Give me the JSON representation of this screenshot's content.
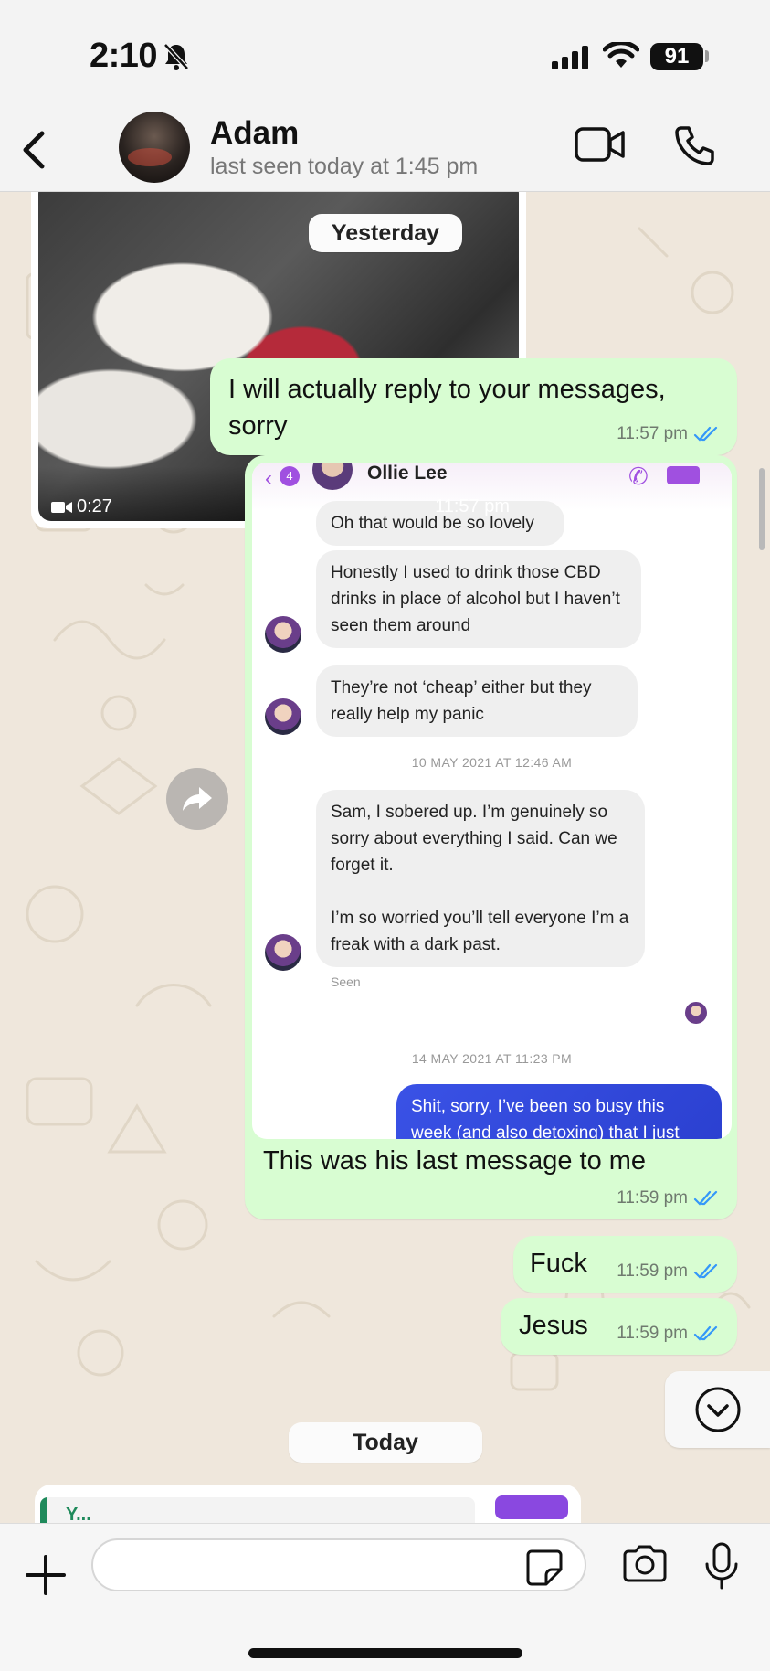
{
  "status_bar": {
    "time": "2:10",
    "battery": "91"
  },
  "header": {
    "contact_name": "Adam",
    "last_seen": "last seen today at 1:45 pm"
  },
  "media_message": {
    "duration": "0:27",
    "time": "11:57 pm"
  },
  "date_yesterday": "Yesterday",
  "messages": [
    {
      "text": "I will actually  reply to your messages, sorry",
      "time": "11:57 pm"
    },
    {
      "caption": "This was his last message to me",
      "time": "11:59 pm"
    },
    {
      "text": "Fuck",
      "time": "11:59 pm"
    },
    {
      "text": "Jesus",
      "time": "11:59 pm"
    }
  ],
  "screenshot": {
    "contact_name": "Ollie Lee",
    "badge": "4",
    "bubbles": [
      "Oh that would be so lovely",
      "Honestly I used to drink those CBD drinks in place of alcohol but I haven’t seen them around",
      "They’re not ‘cheap’ either but they really help my panic",
      "Sam, I sobered up. I’m genuinely so sorry about everything I said. Can we forget it.\n\nI’m so worried you’ll tell everyone I’m a freak with a dark past."
    ],
    "stamp_1": "10 MAY 2021 AT 12:46 AM",
    "seen": "Seen",
    "stamp_2": "14 MAY 2021 AT 11:23 PM",
    "outgoing": "Shit, sorry, I’ve been so busy this week (and also detoxing) that I just"
  },
  "date_today": "Today",
  "reply_preview": {
    "text": "Y..."
  },
  "input": {
    "placeholder": ""
  },
  "colors": {
    "outgoing_bubble": "#d8fdd2",
    "read_ticks": "#3497f9",
    "chat_background": "#efe7dc"
  }
}
